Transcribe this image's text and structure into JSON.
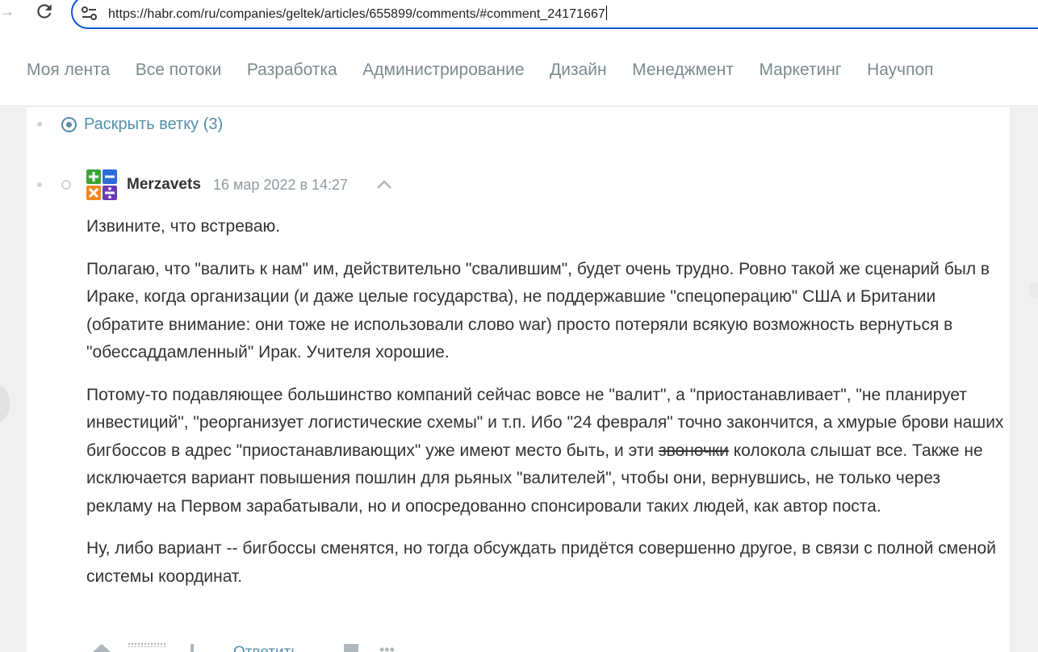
{
  "browser": {
    "url": "https://habr.com/ru/companies/geltek/articles/655899/comments/#comment_24171667"
  },
  "habr_nav": {
    "items": [
      "Моя лента",
      "Все потоки",
      "Разработка",
      "Администрирование",
      "Дизайн",
      "Менеджмент",
      "Маркетинг",
      "Научпоп"
    ]
  },
  "thread": {
    "expand_label": "Раскрыть ветку (3)",
    "comment": {
      "author": "Merzavets",
      "time": "16 мар 2022 в 14:27",
      "paragraph_1": "Извините, что встреваю.",
      "paragraph_2": "Полагаю, что \"валить к нам\" им, действительно \"свалившим\", будет очень трудно. Ровно такой же сценарий был в Ираке, когда организации (и даже целые государства), не поддержавшие \"спецоперацию\" США и Британии (обратите внимание: они тоже не использовали слово war) просто потеряли всякую возможность вернуться в \"обессаддамленный\" Ирак. Учителя хорошие.",
      "paragraph_3_before": "Потому-то подавляющее большинство компаний сейчас вовсе не \"валит\", а \"приостанавливает\", \"не планирует инвестиций\", \"реорганизует логистические схемы\" и т.п. Ибо \"24 февраля\" точно закончится, а хмурые брови наших бигбоссов в адрес \"приостанавливающих\" уже имеют место быть, и эти ",
      "paragraph_3_struck": "звоночки",
      "paragraph_3_after": " колокола слышат все. Также не исключается вариант повышения пошлин для рьяных \"валителей\", чтобы они, вернувшись, не только через рекламу на Первом зарабатывали, но и опосредованно спонсировали таких людей, как автор поста.",
      "paragraph_4": "Ну, либо вариант -- бигбоссы сменятся, но тогда обсуждать придётся совершенно другое, в связи с полной сменой системы координат.",
      "reply_label": "Ответить"
    }
  },
  "icons": {
    "forward": "arrow-right-icon",
    "reload": "reload-icon",
    "site_info": "tune-icon",
    "expand": "target-icon",
    "avatar": "calculator-avatar",
    "collapse": "chevron-up-icon",
    "vote_up": "arrow-up-icon",
    "vote_down": "arrow-down-icon",
    "bookmark": "bookmark-icon",
    "more": "more-icon"
  },
  "colors": {
    "link": "#548eaa",
    "nav_text": "#7b8a8e",
    "omnibox_border": "#0b57d0",
    "meta_text": "#909aa0",
    "body_text": "#333333",
    "avatar_green": "#3aa535",
    "avatar_blue": "#2b6dd6",
    "avatar_orange": "#f2871d",
    "avatar_purple": "#6b3bb3"
  }
}
